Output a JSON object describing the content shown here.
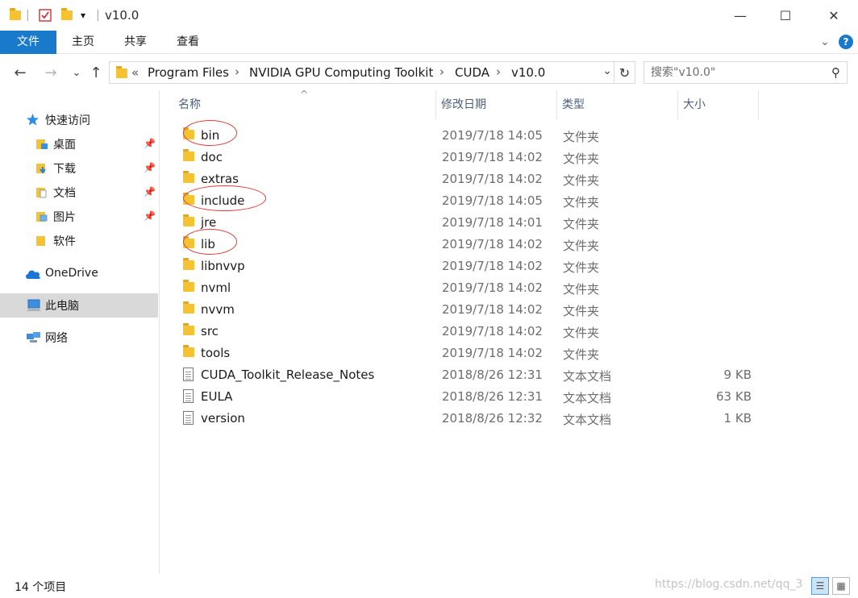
{
  "window": {
    "title": "v10.0",
    "qa_separator": "|",
    "qa_dropdown": "▾",
    "minimize": "—",
    "maximize": "☐",
    "close": "✕"
  },
  "ribbon": {
    "tabs": [
      "文件",
      "主页",
      "共享",
      "查看"
    ],
    "expand": "⌄",
    "help": "?"
  },
  "address": {
    "back": "←",
    "forward": "→",
    "recent": "⌄",
    "up": "↑",
    "overflow": "«",
    "crumbs": [
      "Program Files",
      "NVIDIA GPU Computing Toolkit",
      "CUDA",
      "v10.0"
    ],
    "separator": "›",
    "dropdown": "⌄",
    "refresh": "↻"
  },
  "search": {
    "placeholder": "搜索\"v10.0\"",
    "icon": "⚲"
  },
  "nav": {
    "quick_access": "快速访问",
    "pinned": [
      {
        "label": "桌面",
        "icon": "desktop-icon",
        "pin": "📌"
      },
      {
        "label": "下载",
        "icon": "downloads-icon",
        "pin": "📌"
      },
      {
        "label": "文档",
        "icon": "documents-icon",
        "pin": "📌"
      },
      {
        "label": "图片",
        "icon": "pictures-icon",
        "pin": "📌"
      },
      {
        "label": "软件",
        "icon": "folder-icon",
        "pin": ""
      }
    ],
    "onedrive": "OneDrive",
    "this_pc": "此电脑",
    "network": "网络"
  },
  "columns": {
    "name": "名称",
    "date": "修改日期",
    "type": "类型",
    "size": "大小",
    "sort_indicator": "^"
  },
  "files": [
    {
      "name": "bin",
      "date": "2019/7/18 14:05",
      "type": "文件夹",
      "size": "",
      "kind": "folder",
      "circled": true
    },
    {
      "name": "doc",
      "date": "2019/7/18 14:02",
      "type": "文件夹",
      "size": "",
      "kind": "folder",
      "circled": false
    },
    {
      "name": "extras",
      "date": "2019/7/18 14:02",
      "type": "文件夹",
      "size": "",
      "kind": "folder",
      "circled": false
    },
    {
      "name": "include",
      "date": "2019/7/18 14:05",
      "type": "文件夹",
      "size": "",
      "kind": "folder",
      "circled": true
    },
    {
      "name": "jre",
      "date": "2019/7/18 14:01",
      "type": "文件夹",
      "size": "",
      "kind": "folder",
      "circled": false
    },
    {
      "name": "lib",
      "date": "2019/7/18 14:02",
      "type": "文件夹",
      "size": "",
      "kind": "folder",
      "circled": true
    },
    {
      "name": "libnvvp",
      "date": "2019/7/18 14:02",
      "type": "文件夹",
      "size": "",
      "kind": "folder",
      "circled": false
    },
    {
      "name": "nvml",
      "date": "2019/7/18 14:02",
      "type": "文件夹",
      "size": "",
      "kind": "folder",
      "circled": false
    },
    {
      "name": "nvvm",
      "date": "2019/7/18 14:02",
      "type": "文件夹",
      "size": "",
      "kind": "folder",
      "circled": false
    },
    {
      "name": "src",
      "date": "2019/7/18 14:02",
      "type": "文件夹",
      "size": "",
      "kind": "folder",
      "circled": false
    },
    {
      "name": "tools",
      "date": "2019/7/18 14:02",
      "type": "文件夹",
      "size": "",
      "kind": "folder",
      "circled": false
    },
    {
      "name": "CUDA_Toolkit_Release_Notes",
      "date": "2018/8/26 12:31",
      "type": "文本文档",
      "size": "9 KB",
      "kind": "text",
      "circled": false
    },
    {
      "name": "EULA",
      "date": "2018/8/26 12:31",
      "type": "文本文档",
      "size": "63 KB",
      "kind": "text",
      "circled": false
    },
    {
      "name": "version",
      "date": "2018/8/26 12:32",
      "type": "文本文档",
      "size": "1 KB",
      "kind": "text",
      "circled": false
    }
  ],
  "status": {
    "item_count": "14 个项目",
    "watermark": "https://blog.csdn.net/qq_3",
    "details_view": "☰",
    "icons_view": "▦"
  },
  "colors": {
    "accent": "#1979ca",
    "folder": "#f5c232",
    "annotation": "#e23a3a",
    "selected_nav": "#d9d9d9"
  }
}
